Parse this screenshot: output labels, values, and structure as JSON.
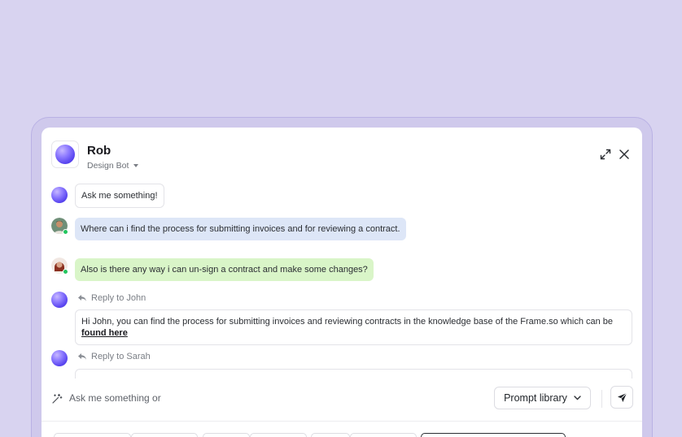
{
  "header": {
    "name": "Rob",
    "subtitle": "Design Bot"
  },
  "messages": [
    {
      "sender": "bot",
      "text": "Ask me something!"
    },
    {
      "sender": "john",
      "text": "Where can i find the process for submitting invoices and for reviewing a contract."
    },
    {
      "sender": "sarah",
      "text": "Also is there any way i can un-sign a contract and make some changes?"
    }
  ],
  "replies": [
    {
      "label": "Reply to John",
      "text": "Hi John, you can find the process for submitting invoices and reviewing contracts in the knowledge base of the Frame.so which can be",
      "link": "found here"
    },
    {
      "label": "Reply to Sarah"
    }
  ],
  "composer": {
    "placeholder": "Ask me something or",
    "prompt_library_label": "Prompt library"
  },
  "colors": {
    "background": "#d8d3f0",
    "bot_orb": "#5a46f0",
    "user_bubble_blue": "#dde6f7",
    "user_bubble_green": "#d9f5c8",
    "online": "#22c55e"
  }
}
